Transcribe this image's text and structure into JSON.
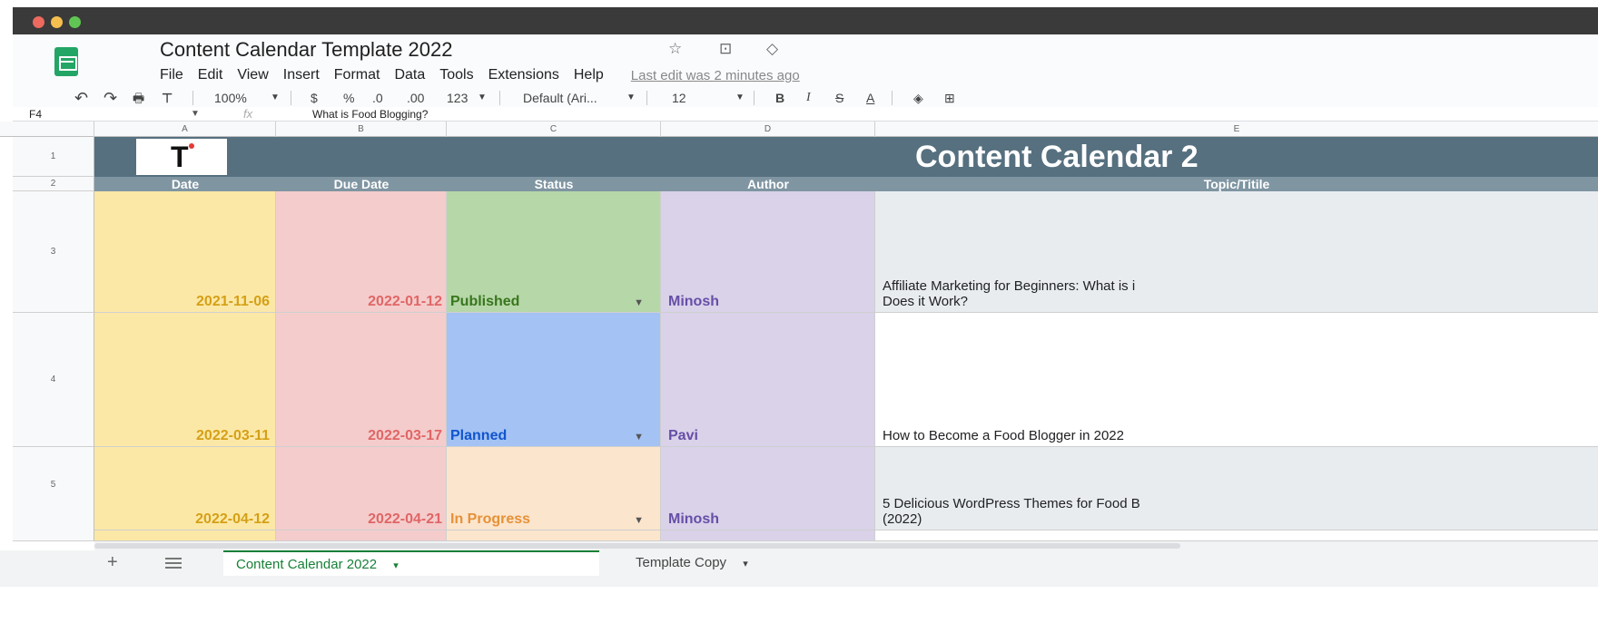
{
  "window": {
    "traffic_lights": [
      "#ed6a5e",
      "#f5bf4f",
      "#61c554"
    ]
  },
  "header": {
    "app_icon": "sheets-icon",
    "title": "Content Calendar Template 2022",
    "title_icons": [
      "star-icon",
      "move-folder-icon",
      "cloud-status-icon"
    ],
    "title_icon_glyphs": [
      "☆",
      "⊡",
      "◇"
    ],
    "menu": [
      "File",
      "Edit",
      "View",
      "Insert",
      "Format",
      "Data",
      "Tools",
      "Extensions",
      "Help"
    ],
    "last_edit": "Last edit was 2 minutes ago"
  },
  "toolbar": {
    "undo": "↶",
    "redo": "↷",
    "print": "🖶",
    "paint_format": "⊤",
    "zoom": "100%",
    "currency": "$",
    "percent": "%",
    "decrease_decimal": ".0",
    "increase_decimal": ".00",
    "more_formats": "123",
    "font": "Default (Ari...",
    "font_size": "12",
    "bold": "B",
    "italic": "I",
    "strikethrough": "S",
    "text_color": "A",
    "fill_icon": "◈",
    "borders_icon": "⊞"
  },
  "formula_bar": {
    "name_box": "F4",
    "fx": "fx",
    "value": "What is Food Blogging?"
  },
  "columns": [
    "A",
    "B",
    "C",
    "D",
    "E"
  ],
  "rows": [
    "1",
    "2",
    "3",
    "4",
    "5"
  ],
  "sheet": {
    "banner_title": "Content Calendar 2",
    "logo_letter": "T",
    "headers": {
      "date": "Date",
      "due_date": "Due Date",
      "status": "Status",
      "author": "Author",
      "topic": "Topic/Titile"
    },
    "entries": [
      {
        "date": "2021-11-06",
        "due": "2022-01-12",
        "status": "Published",
        "author": "Minosh",
        "topic_line1": "Affiliate Marketing for Beginners: What is i",
        "topic_line2": "Does it Work?"
      },
      {
        "date": "2022-03-11",
        "due": "2022-03-17",
        "status": "Planned",
        "author": "Pavi",
        "topic_line1": "How to Become a Food Blogger in 2022",
        "topic_line2": ""
      },
      {
        "date": "2022-04-12",
        "due": "2022-04-21",
        "status": "In Progress",
        "author": "Minosh",
        "topic_line1": "5 Delicious WordPress Themes for Food B",
        "topic_line2": "(2022)"
      }
    ],
    "colors": {
      "date_bg": "#fce8a6",
      "date_text": "#d4a017",
      "due_bg": "#f4cccc",
      "due_text": "#e06666",
      "published_bg": "#b6d7a8",
      "published_text": "#38761d",
      "planned_bg": "#a4c2f4",
      "planned_text": "#1155cc",
      "inprogress_bg": "#fce5cd",
      "inprogress_text": "#e69138",
      "author_bg": "#d9d2e9",
      "author_text": "#674ea7",
      "topic_bg": "#e9ecef"
    }
  },
  "sheet_tabs": {
    "add": "+",
    "active": "Content Calendar 2022",
    "other": "Template Copy",
    "caret": "▾"
  }
}
